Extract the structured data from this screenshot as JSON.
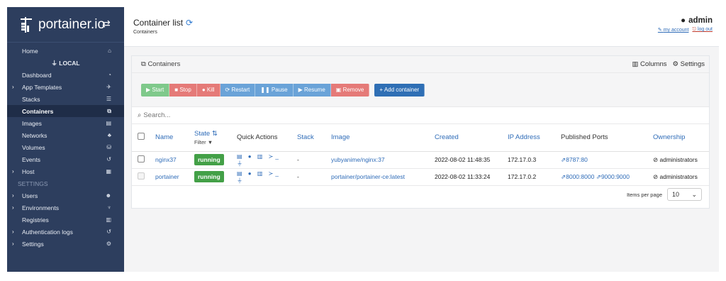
{
  "brand": {
    "name": "portainer.io",
    "toggle_icon": "swap-icon"
  },
  "sidebar": {
    "items": [
      {
        "label": "Home",
        "icon": "⌂"
      },
      {
        "label": "LOCAL"
      },
      {
        "label": "Dashboard",
        "icon": "◔"
      },
      {
        "label": "App Templates",
        "icon": "✈",
        "caret": true
      },
      {
        "label": "Stacks",
        "icon": "☰"
      },
      {
        "label": "Containers",
        "icon": "⧉",
        "active": true
      },
      {
        "label": "Images",
        "icon": "▤"
      },
      {
        "label": "Networks",
        "icon": "♣"
      },
      {
        "label": "Volumes",
        "icon": "⛁"
      },
      {
        "label": "Events",
        "icon": "↺"
      },
      {
        "label": "Host",
        "icon": "▦",
        "caret": true
      },
      {
        "label": "SETTINGS"
      },
      {
        "label": "Users",
        "icon": "☻",
        "caret": true
      },
      {
        "label": "Environments",
        "icon": "♆",
        "caret": true
      },
      {
        "label": "Registries",
        "icon": "▥"
      },
      {
        "label": "Authentication logs",
        "icon": "↺",
        "caret": true
      },
      {
        "label": "Settings",
        "icon": "⚙",
        "caret": true
      }
    ]
  },
  "header": {
    "title": "Container list",
    "breadcrumb": "Containers",
    "user": "admin",
    "my_account": "my account",
    "log_out": "log out"
  },
  "panel": {
    "title": "Containers",
    "columns_label": "Columns",
    "settings_label": "Settings",
    "buttons": {
      "start": "Start",
      "stop": "Stop",
      "kill": "Kill",
      "restart": "Restart",
      "pause": "Pause",
      "resume": "Resume",
      "remove": "Remove",
      "add": "+ Add container"
    },
    "search_placeholder": "Search...",
    "headers": {
      "name": "Name",
      "state": "State",
      "filter": "Filter",
      "quick_actions": "Quick Actions",
      "stack": "Stack",
      "image": "Image",
      "created": "Created",
      "ip": "IP Address",
      "ports": "Published Ports",
      "ownership": "Ownership"
    },
    "rows": [
      {
        "name": "nginx37",
        "state": "running",
        "stack": "-",
        "image": "yubyanime/nginx:37",
        "created": "2022-08-02 11:48:35",
        "ip": "172.17.0.3",
        "ports": "8787:80",
        "ownership": "administrators"
      },
      {
        "name": "portainer",
        "state": "running",
        "stack": "-",
        "image": "portainer/portainer-ce:latest",
        "created": "2022-08-02 11:33:24",
        "ip": "172.17.0.2",
        "ports": "8000:8000",
        "ports2": "9000:9000",
        "ownership": "administrators"
      }
    ],
    "items_per_page_label": "Items per page",
    "items_per_page_value": "10"
  },
  "colors": {
    "sidebar": "#2d3e5e",
    "accent": "#2f6cb8",
    "running": "#43a047"
  }
}
